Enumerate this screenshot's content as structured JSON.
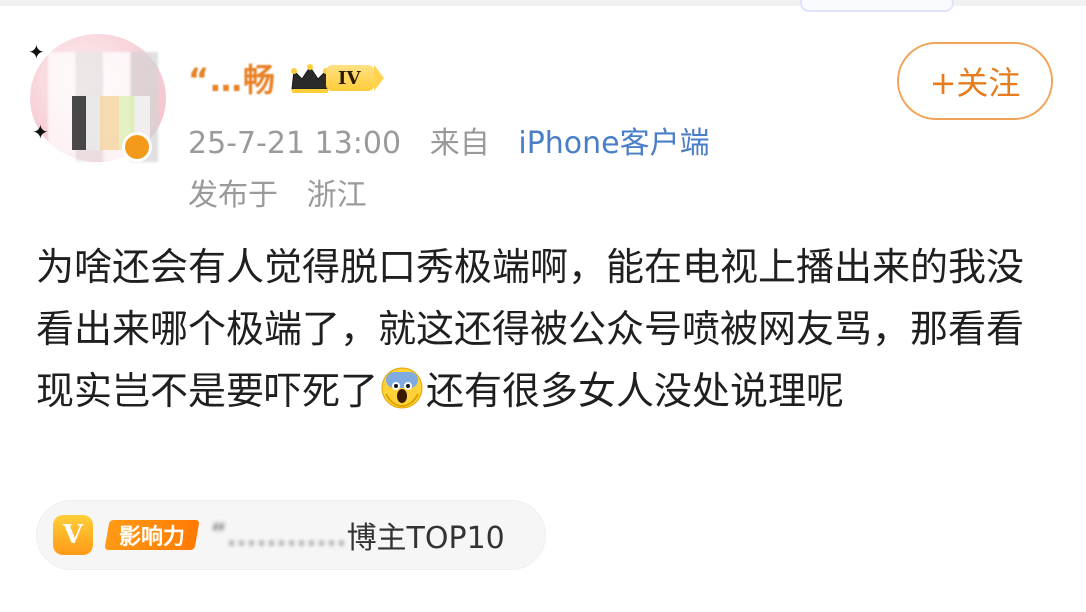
{
  "post": {
    "username": "“…畅",
    "level_badge": "IV",
    "follow_button": "+关注",
    "meta": {
      "timestamp": "25-7-21 13:00",
      "from_prefix": "来自",
      "client": "iPhone客户端",
      "location_prefix": "发布于",
      "location": "浙江"
    },
    "content": {
      "text_before_emoji": "为啥还会有人觉得脱口秀极端啊，能在电视上播出来的我没看出来哪个极端了，就这还得被公众号喷被网友骂，那看看现实岂不是要吓死了",
      "emoji_name": "screaming-face",
      "text_after_emoji": "还有很多女人没处说理呢"
    },
    "influence": {
      "logo_letter": "V",
      "tag": "影响力",
      "text_blurred": "“…………",
      "text_suffix": "博主TOP10"
    }
  },
  "colors": {
    "orange_accent": "#e67c1c",
    "link_blue": "#4a7ec9",
    "meta_gray": "#9a9a9a",
    "text_dark": "#1f1f1f"
  }
}
